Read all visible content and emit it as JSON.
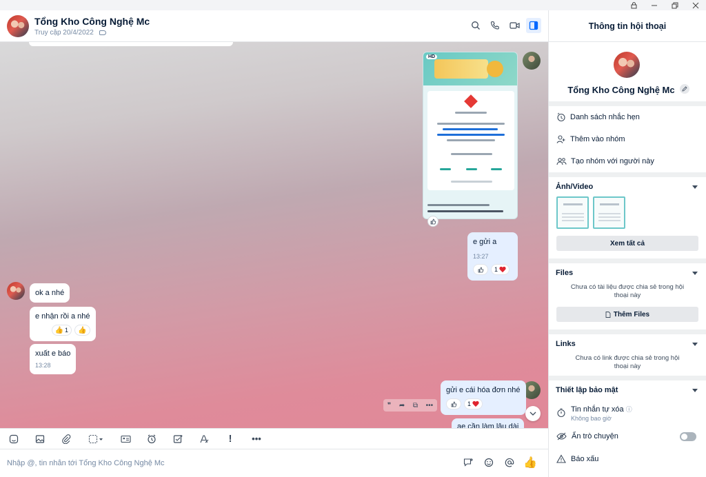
{
  "window": {
    "controls": [
      "lock",
      "minimize",
      "restore",
      "close"
    ]
  },
  "header": {
    "name": "Tổng Kho Công Nghệ Mc",
    "last_access": "Truy cập 20/4/2022"
  },
  "messages": {
    "image_badge": "HD",
    "m1": {
      "text": "e gửi a",
      "time": "13:27",
      "reaction_count": "1"
    },
    "m2": {
      "text": "ok a nhé"
    },
    "m3": {
      "text": "e nhận rồi a nhé",
      "reaction_count": "1"
    },
    "m4": {
      "text": "xuất e báo",
      "time": "13:28"
    },
    "m5": {
      "text": "gửi e cái hóa đơn nhé",
      "reaction_count": "1"
    },
    "m6": {
      "text": "ae cần làm lâu dài"
    }
  },
  "hover_actions": [
    "quote",
    "forward",
    "pin",
    "more"
  ],
  "composer": {
    "placeholder": "Nhập @, tin nhắn tới Tổng Kho Công Nghệ Mc"
  },
  "panel": {
    "title": "Thông tin hội thoại",
    "name": "Tổng Kho Công Nghệ Mc",
    "actions": [
      {
        "label": "Danh sách nhắc hẹn",
        "icon": "clock-icon"
      },
      {
        "label": "Thêm vào nhóm",
        "icon": "add-member-icon"
      },
      {
        "label": "Tạo nhóm với người này",
        "icon": "group-icon"
      }
    ],
    "media": {
      "title": "Ảnh/Video",
      "view_all": "Xem tất cả"
    },
    "files": {
      "title": "Files",
      "empty": "Chưa có tài liệu được chia sẻ trong hội thoại này",
      "button": "Thêm Files"
    },
    "links": {
      "title": "Links",
      "empty": "Chưa có link được chia sẻ trong hội thoại này"
    },
    "security": {
      "title": "Thiết lập bảo mật",
      "auto_delete": "Tin nhắn tự xóa",
      "auto_delete_value": "Không bao giờ",
      "hide_chat": "Ẩn trò chuyện",
      "report": "Báo xấu"
    }
  },
  "colors": {
    "accent": "#0068ff",
    "me_bubble": "#e5efff",
    "heart": "#e0242f",
    "like": "#f2a81d"
  }
}
